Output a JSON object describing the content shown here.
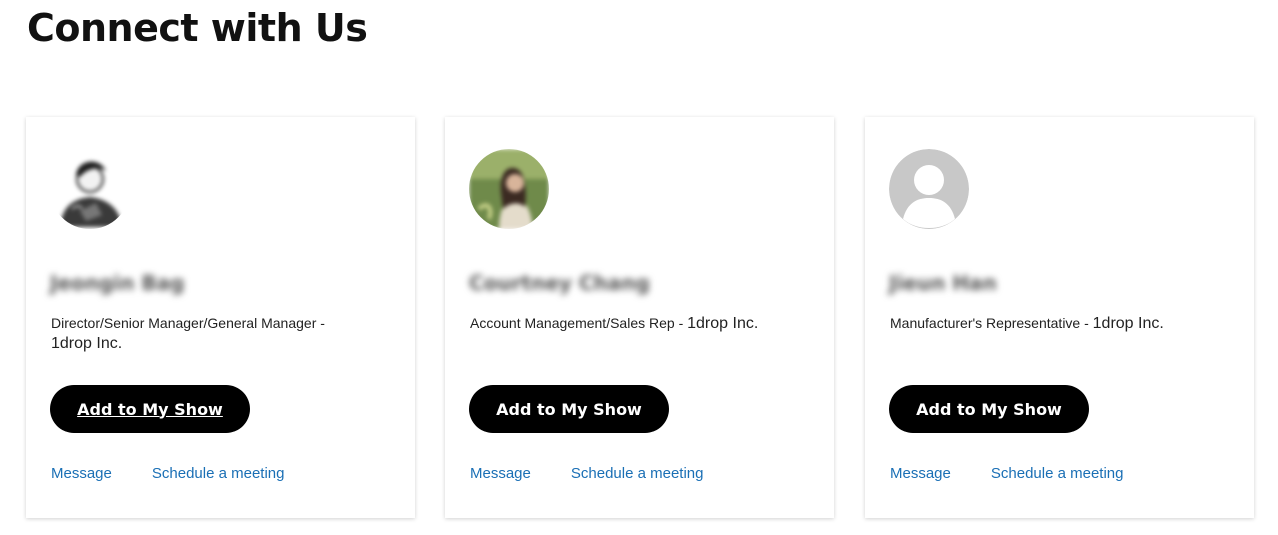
{
  "page": {
    "title": "Connect with Us"
  },
  "cards": [
    {
      "avatar": "blurred-portrait-sketch",
      "name": "Jeongin Bag",
      "role": "Director/Senior Manager/General Manager -",
      "company": "1drop Inc.",
      "add_label": "Add to My Show",
      "message_label": "Message",
      "schedule_label": "Schedule a meeting"
    },
    {
      "avatar": "blurred-portrait-photo",
      "name": "Courtney Chang",
      "role": "Account Management/Sales Rep -",
      "company": "1drop Inc.",
      "add_label": "Add to My Show",
      "message_label": "Message",
      "schedule_label": "Schedule a meeting"
    },
    {
      "avatar": "default-user-icon",
      "name": "Jieun Han",
      "role": "Manufacturer's Representative -",
      "company": "1drop Inc.",
      "add_label": "Add to My Show",
      "message_label": "Message",
      "schedule_label": "Schedule a meeting"
    }
  ],
  "colors": {
    "button_bg": "#000000",
    "link": "#1a6fb5",
    "placeholder_avatar": "#c8c8c8"
  }
}
